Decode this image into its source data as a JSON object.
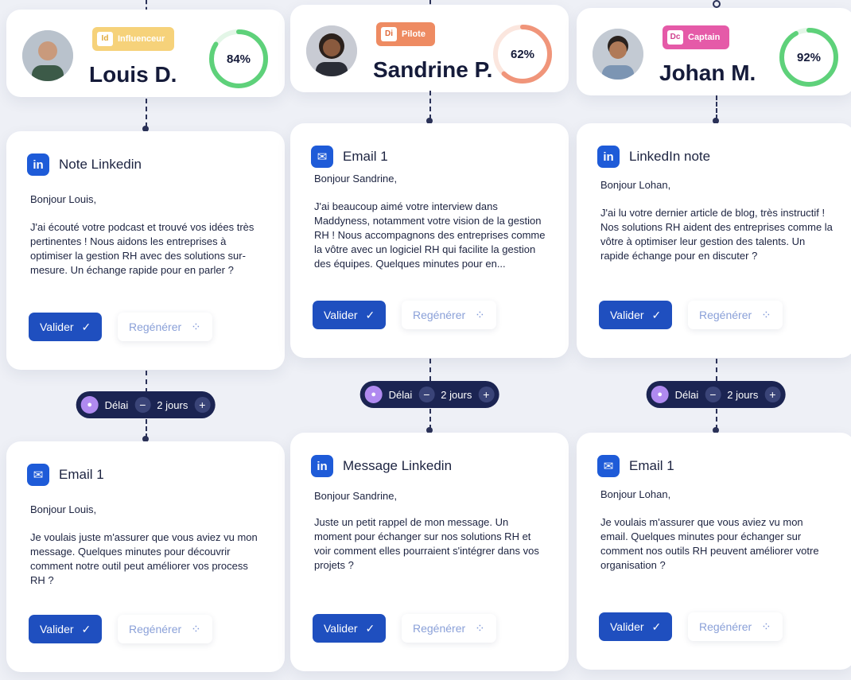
{
  "colors": {
    "accent_blue": "#1f4fbf",
    "ring_green": "#5ed17a",
    "ring_orange": "#f0957a",
    "delay_bg": "#1b2452",
    "badge_influenceur": "#f6d27a",
    "badge_pilote": "#ee8b62",
    "badge_captain": "#e55aa8"
  },
  "columns": [
    {
      "profile": {
        "name": "Louis D.",
        "role_code": "Id",
        "role_label": "Influenceur",
        "score_label": "84%",
        "score_value": 84,
        "avatar_icon": "avatar-man-icon"
      },
      "message1": {
        "channel_icon": "linkedin-icon",
        "channel_glyph": "in",
        "title": "Note Linkedin",
        "greeting": "Bonjour Louis,",
        "body": "J'ai écouté votre podcast et trouvé vos idées très pertinentes ! Nous aidons les entreprises à optimiser la gestion RH avec des solutions sur-mesure. Un échange rapide pour en parler ?",
        "validate_label": "Valider",
        "regen_label": "Regénérer"
      },
      "delay": {
        "label": "Délai",
        "value": "2 jours"
      },
      "message2": {
        "channel_icon": "email-icon",
        "channel_glyph": "✉",
        "title": "Email 1",
        "greeting": "Bonjour Louis,",
        "body": "Je voulais juste m'assurer que vous aviez vu mon message. Quelques minutes pour découvrir comment notre outil peut améliorer vos process RH ?",
        "validate_label": "Valider",
        "regen_label": "Regénérer"
      }
    },
    {
      "profile": {
        "name": "Sandrine P.",
        "role_code": "Di",
        "role_label": "Pilote",
        "score_label": "62%",
        "score_value": 62,
        "avatar_icon": "avatar-woman-icon"
      },
      "message1": {
        "channel_icon": "email-icon",
        "channel_glyph": "✉",
        "title": "Email 1",
        "greeting": "Bonjour Sandrine,",
        "body": "J'ai beaucoup aimé votre interview dans Maddyness, notamment votre vision de la gestion RH ! Nous accompagnons des entreprises comme la vôtre avec un logiciel RH qui facilite la gestion des équipes. Quelques minutes pour en...",
        "validate_label": "Valider",
        "regen_label": "Regénérer"
      },
      "delay": {
        "label": "Délai",
        "value": "2 jours"
      },
      "message2": {
        "channel_icon": "linkedin-icon",
        "channel_glyph": "in",
        "title": "Message Linkedin",
        "greeting": "Bonjour Sandrine,",
        "body": "Juste un petit rappel de mon message. Un moment pour échanger sur nos solutions RH et voir comment elles pourraient s'intégrer dans vos projets ?",
        "validate_label": "Valider",
        "regen_label": "Regénérer"
      }
    },
    {
      "profile": {
        "name": "Johan M.",
        "role_code": "Dc",
        "role_label": "Captain",
        "score_label": "92%",
        "score_value": 92,
        "avatar_icon": "avatar-man-icon"
      },
      "message1": {
        "channel_icon": "linkedin-icon",
        "channel_glyph": "in",
        "title": "LinkedIn note",
        "greeting": "Bonjour Lohan,",
        "body": "J'ai lu votre dernier article de blog, très instructif ! Nos solutions RH aident des entreprises comme la vôtre à optimiser leur gestion des talents. Un rapide échange pour en discuter ?",
        "validate_label": "Valider",
        "regen_label": "Regénérer"
      },
      "delay": {
        "label": "Délai",
        "value": "2 jours"
      },
      "message2": {
        "channel_icon": "email-icon",
        "channel_glyph": "✉",
        "title": "Email 1",
        "greeting": "Bonjour Lohan,",
        "body": "Je voulais m'assurer que vous aviez vu mon email. Quelques minutes pour échanger sur comment nos outils RH peuvent améliorer votre organisation ?",
        "validate_label": "Valider",
        "regen_label": "Regénérer"
      }
    }
  ]
}
